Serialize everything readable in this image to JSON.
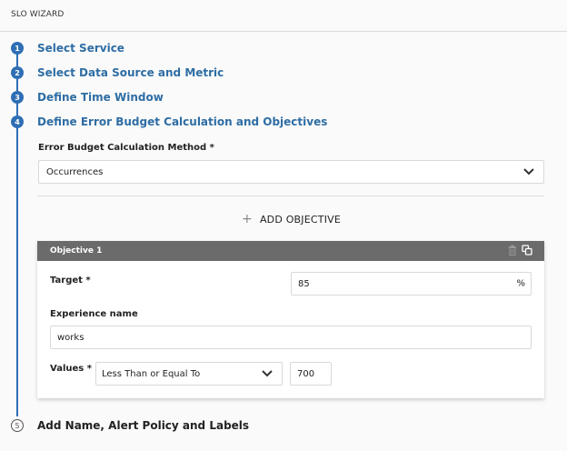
{
  "header": {
    "title": "SLO WIZARD"
  },
  "steps": [
    {
      "number": "1",
      "title": "Select Service"
    },
    {
      "number": "2",
      "title": "Select Data Source and Metric"
    },
    {
      "number": "3",
      "title": "Define Time Window"
    },
    {
      "number": "4",
      "title": "Define Error Budget Calculation and Objectives"
    },
    {
      "number": "5",
      "title": "Add Name, Alert Policy and Labels"
    }
  ],
  "error_budget": {
    "label": "Error Budget Calculation Method *",
    "value": "Occurrences"
  },
  "add_objective_label": "ADD OBJECTIVE",
  "objective": {
    "title": "Objective 1",
    "target_label": "Target *",
    "target_value": "85",
    "target_unit": "%",
    "experience_label": "Experience name",
    "experience_value": "works",
    "values_label": "Values *",
    "operator_value": "Less Than or Equal To",
    "threshold_value": "700"
  },
  "colors": {
    "accent": "#2f6eb4",
    "card_header": "#6b6b6b"
  }
}
